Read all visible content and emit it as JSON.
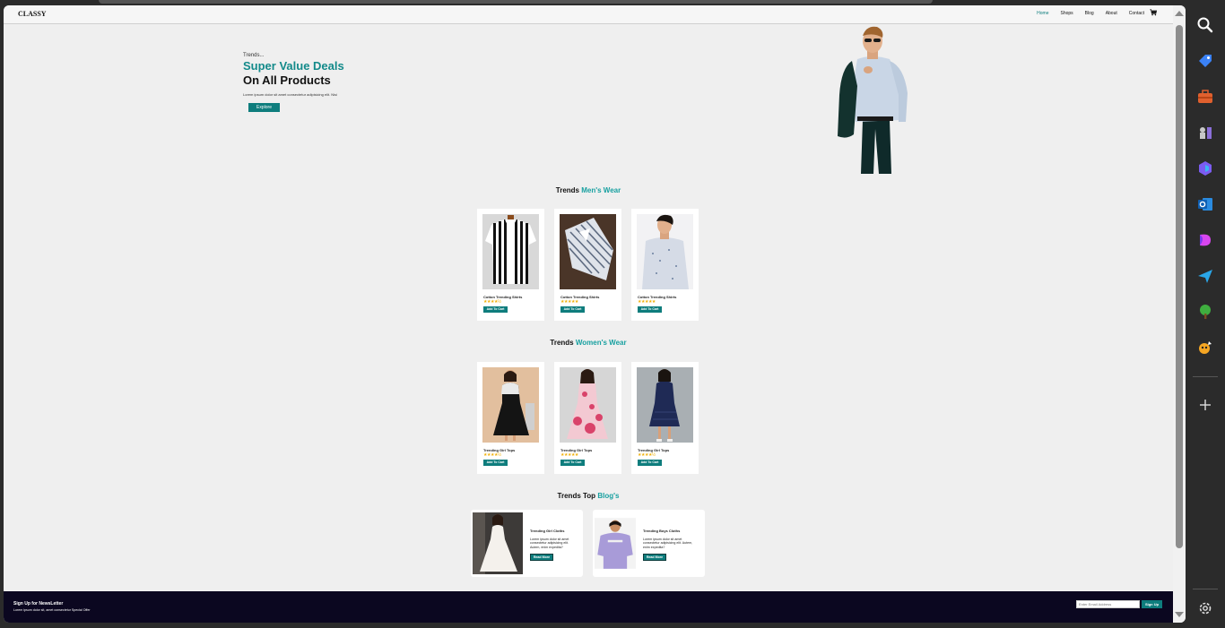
{
  "navbar": {
    "brand": "CLASSY",
    "links": [
      "Home",
      "Shops",
      "Blog",
      "About",
      "Contact"
    ]
  },
  "hero": {
    "kicker": "Trends...",
    "title_line1": "Super Value Deals",
    "title_line2": "On All Products",
    "description": "Lorem ipsum dolor sit amet consectetur adipisicing elit. Nisi",
    "explore_label": "Explore"
  },
  "mens_section": {
    "title_prefix": "Trends",
    "title_highlight": "Men's Wear",
    "products": [
      {
        "name": "Cotton Trending Shirts",
        "stars": "★★★★½",
        "rating": 4.5,
        "button": "Add To Cart"
      },
      {
        "name": "Cotton Trending Shirts",
        "stars": "★★★★★",
        "rating": 5,
        "button": "Add To Cart"
      },
      {
        "name": "Cotton Trending Shirts",
        "stars": "★★★★★",
        "rating": 5,
        "button": "Add To Cart"
      }
    ]
  },
  "womens_section": {
    "title_prefix": "Trends",
    "title_highlight": "Women's Wear",
    "products": [
      {
        "name": "Trending Girl Tops",
        "stars": "★★★★½",
        "rating": 4.5,
        "button": "Add To Cart"
      },
      {
        "name": "Trending Girl Tops",
        "stars": "★★★★★",
        "rating": 5,
        "button": "Add To Cart"
      },
      {
        "name": "Trending Girl Tops",
        "stars": "★★★★½",
        "rating": 4.5,
        "button": "Add To Cart"
      }
    ]
  },
  "blog_section": {
    "title_prefix": "Trends Top",
    "title_highlight": "Blog's",
    "posts": [
      {
        "title": "Trending Girl Cloths",
        "text": "Lorem ipsum dolor sit amet consectetur adipisicing elit. Autem, enim expedita?",
        "button": "Read More"
      },
      {
        "title": "Trending Boys Cloths",
        "text": "Lorem ipsum dolor sit amet consectetur adipisicing elit. Autem, enim expedita?",
        "button": "Read More"
      }
    ]
  },
  "footer": {
    "newsletter_title": "Sign Up for NewsLetter",
    "newsletter_sub": "Lorem ipsum dolor sit, amet consectetur Special Offer",
    "email_placeholder": "Enter Email Address",
    "signup_label": "Sign Up"
  },
  "colors": {
    "accent": "#0e7d7d",
    "highlight": "#17a0a0",
    "footer_bg": "#0b0720",
    "star": "#f1b10a"
  },
  "edge_sidebar": {
    "icons": [
      "search-icon",
      "tag-icon",
      "briefcase-icon",
      "chess-icon",
      "copilot-icon",
      "outlook-icon",
      "designer-icon",
      "send-icon",
      "tree-icon",
      "game-icon",
      "add-icon",
      "settings-icon"
    ]
  }
}
